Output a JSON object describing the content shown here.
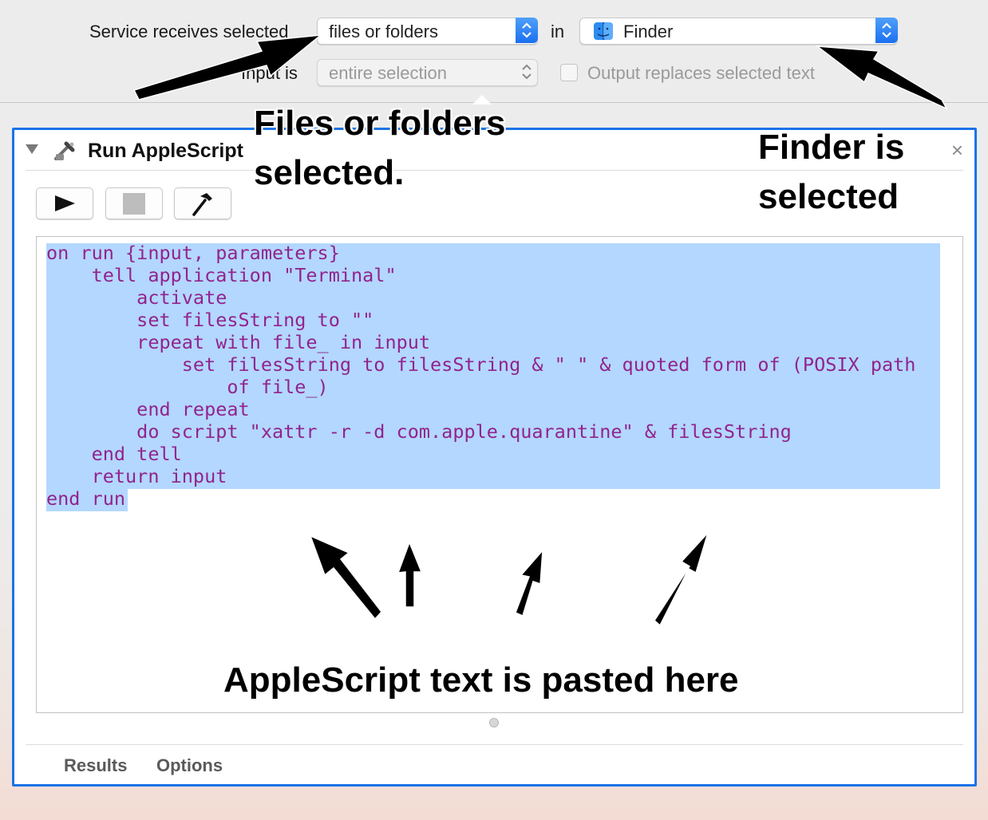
{
  "service": {
    "receives_label": "Service receives selected",
    "receives_value": "files or folders",
    "in_label": "in",
    "app_value": "Finder",
    "input_is_label": "Input is",
    "input_is_value": "entire selection",
    "output_replaces_label": "Output replaces selected text",
    "output_replaces_checked": false
  },
  "action": {
    "title": "Run AppleScript",
    "icon": "applescript-icon",
    "close_symbol": "×",
    "toolbar": {
      "run_icon": "play-icon",
      "stop_icon": "stop-icon",
      "compile_icon": "hammer-icon"
    },
    "script_lines": [
      "on run {input, parameters}",
      "    tell application \"Terminal\"",
      "        activate",
      "        set filesString to \"\"",
      "        repeat with file_ in input",
      "            set filesString to filesString & \" \" & quoted form of (POSIX path",
      "                of file_)",
      "        end repeat",
      "        do script \"xattr -r -d com.apple.quarantine\" & filesString",
      "    end tell",
      "    return input",
      "end run"
    ],
    "tabs": {
      "results": "Results",
      "options": "Options"
    }
  },
  "annotations": {
    "files_line1": "Files or folders",
    "files_line2": "selected.",
    "finder_line1": "Finder is",
    "finder_line2": "selected",
    "pasted": "AppleScript text is pasted here"
  },
  "colors": {
    "accent": "#1a73e8",
    "selection": "#b3d7ff",
    "code_text": "#92238f"
  }
}
